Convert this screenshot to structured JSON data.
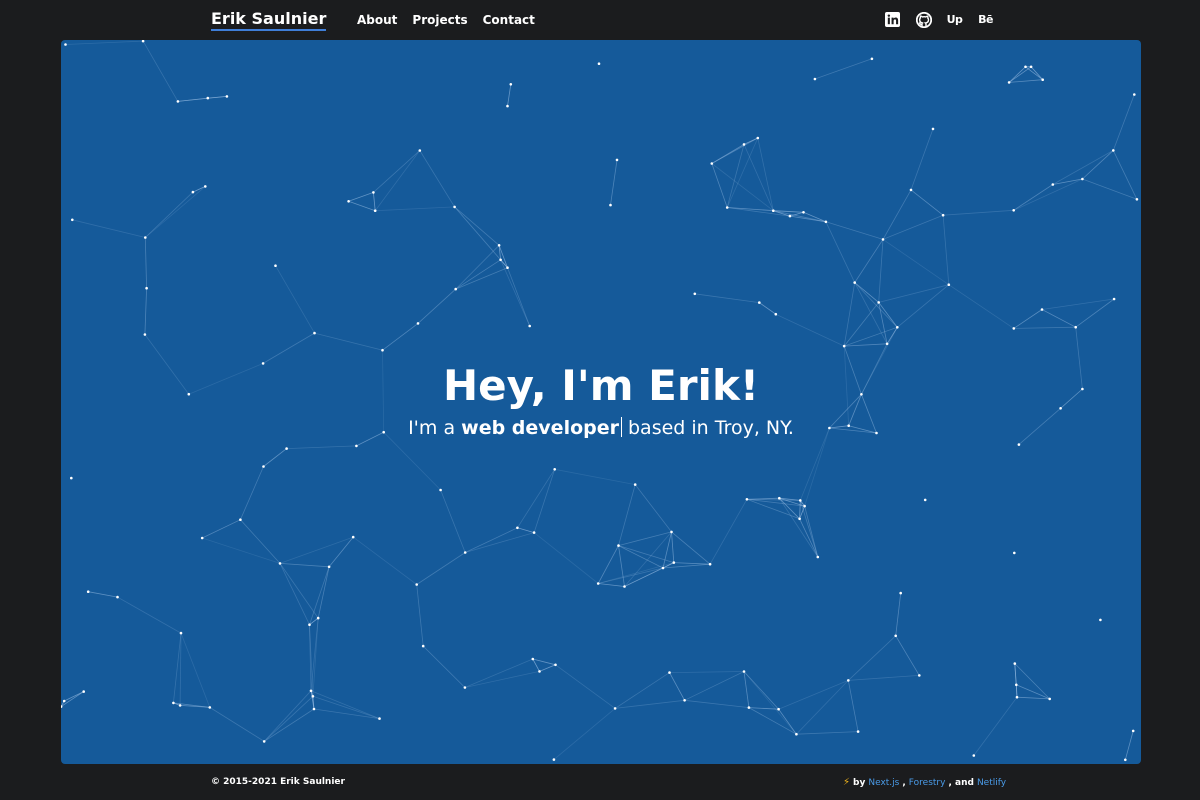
{
  "header": {
    "brand": "Erik Saulnier",
    "nav": [
      {
        "label": "About"
      },
      {
        "label": "Projects"
      },
      {
        "label": "Contact"
      }
    ],
    "social": [
      {
        "name": "linkedin-icon"
      },
      {
        "name": "github-icon"
      },
      {
        "name": "upwork-icon",
        "text": "Up"
      },
      {
        "name": "behance-icon",
        "text": "Bē"
      }
    ]
  },
  "hero": {
    "title": "Hey, I'm Erik!",
    "subtitle_prefix": "I'm a",
    "subtitle_strong": "web developer",
    "subtitle_suffix": "based in Troy, NY.",
    "background_color": "#155a9a"
  },
  "footer": {
    "copyright": "© 2015-2021 Erik Saulnier",
    "by_label": "by",
    "links": [
      {
        "label": "Next.js"
      },
      {
        "label": "Forestry"
      },
      {
        "label": "Netlify"
      }
    ],
    "and_label": ", and",
    "accent_color": "#4a9be8"
  }
}
